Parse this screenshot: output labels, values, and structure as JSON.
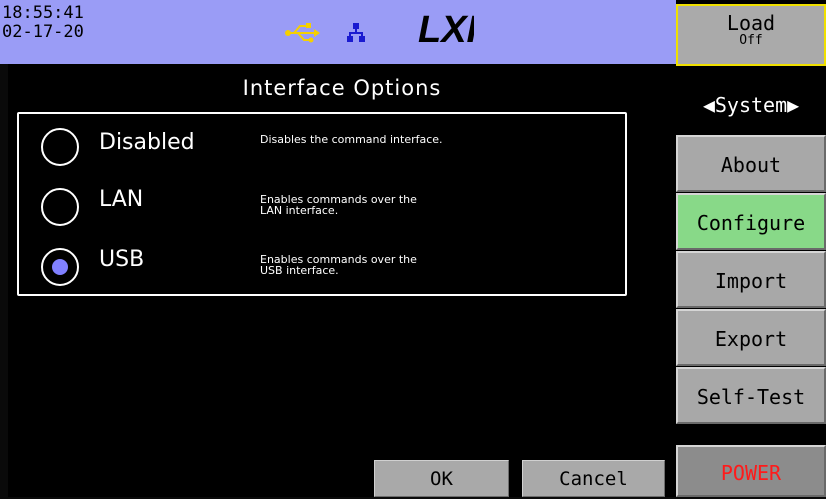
{
  "status": {
    "time": "18:55:41",
    "date": "02-17-20",
    "usb_color": "#f5d000",
    "lan_color": "#1a1ad0",
    "logo_text": "LXI"
  },
  "dialog": {
    "title": "Interface Options",
    "options": [
      {
        "label": "Disabled",
        "description": "Disables the command interface.",
        "selected": false
      },
      {
        "label": "LAN",
        "description": "Enables commands over the\nLAN interface.",
        "selected": false
      },
      {
        "label": "USB",
        "description": "Enables commands over the\nUSB interface.",
        "selected": true
      }
    ],
    "ok_label": "OK",
    "cancel_label": "Cancel"
  },
  "sidebar": {
    "load_label": "Load",
    "load_state": "Off",
    "section_label": "◀System▶",
    "items": [
      {
        "label": "About"
      },
      {
        "label": "Configure",
        "active": true
      },
      {
        "label": "Import"
      },
      {
        "label": "Export"
      },
      {
        "label": "Self-Test"
      }
    ],
    "power_label": "POWER",
    "accent": "#88d988",
    "power_color": "#ff1a1a"
  }
}
